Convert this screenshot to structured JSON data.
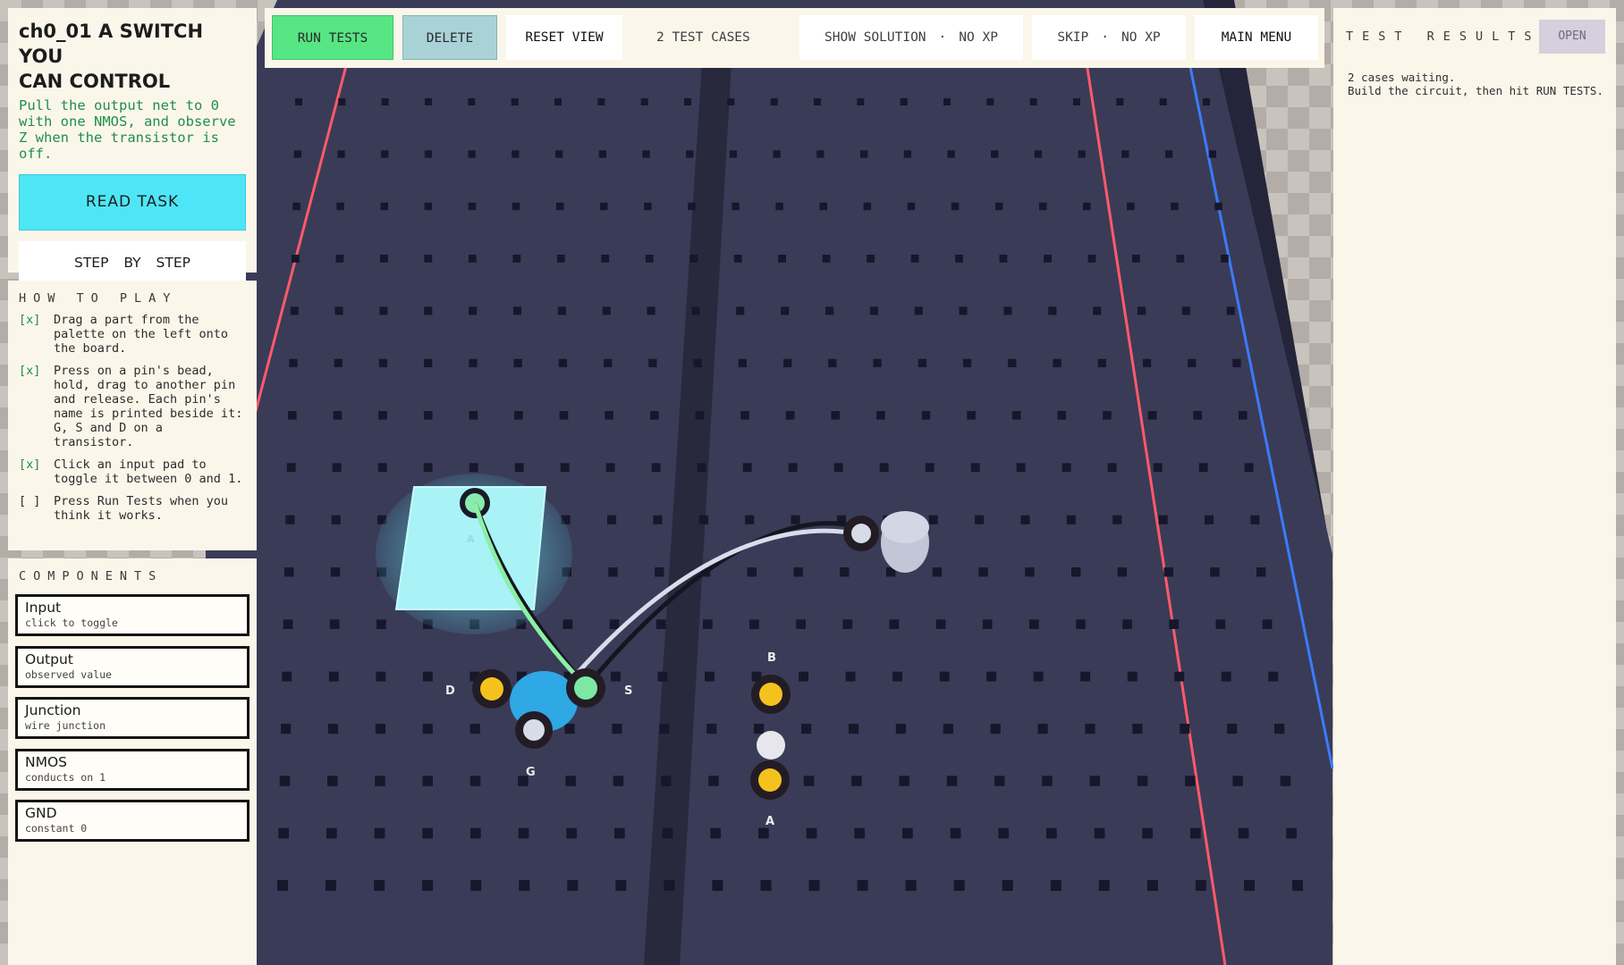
{
  "task": {
    "title": "ch0_01  A SWITCH YOU\nCAN CONTROL",
    "description": "Pull the output net to 0 with one NMOS, and observe Z when the transistor is off.",
    "read_task_label": "READ TASK",
    "step_by_step_label": "STEP  BY  STEP"
  },
  "how_to_play": {
    "heading": "HOW TO PLAY",
    "steps": [
      {
        "mark": "[x]",
        "text": "Drag a part from the palette on the left onto the board.",
        "done": true
      },
      {
        "mark": "[x]",
        "text": "Press on a pin's bead, hold, drag to another pin and release. Each pin's name is printed beside it: G, S and D on a transistor.",
        "done": true
      },
      {
        "mark": "[x]",
        "text": "Click an input pad to toggle it between 0 and 1.",
        "done": true
      },
      {
        "mark": "[ ]",
        "text": "Press Run Tests when you think it works.",
        "done": false
      }
    ]
  },
  "components": {
    "heading": "COMPONENTS",
    "items": [
      {
        "name": "Input",
        "sub": "click to toggle"
      },
      {
        "name": "Output",
        "sub": "observed value"
      },
      {
        "name": "Junction",
        "sub": "wire junction"
      },
      {
        "name": "NMOS",
        "sub": "conducts on 1"
      },
      {
        "name": "GND",
        "sub": "constant 0"
      }
    ]
  },
  "toolbar": {
    "run_tests": "RUN TESTS",
    "delete": "DELETE",
    "reset_view": "RESET VIEW",
    "test_cases": "2 TEST CASES",
    "show_solution": "SHOW SOLUTION",
    "show_solution_cost": "NO XP",
    "skip": "SKIP",
    "skip_cost": "NO XP",
    "separator": "·",
    "main_menu": "MAIN MENU"
  },
  "results": {
    "heading": "TEST RESULTS",
    "open_label": "OPEN",
    "line1": "2 cases waiting.",
    "line2": "Build the circuit, then hit RUN TESTS."
  },
  "board": {
    "pins": {
      "input_pad": "A",
      "nmos_drain": "D",
      "nmos_source": "S",
      "nmos_gate": "G",
      "output_top": "B",
      "output_bottom": "A"
    }
  },
  "colors": {
    "run_tests": "#56e683",
    "delete": "#a9d2d6",
    "read_task": "#4ee6f7",
    "done_mark": "#1f8f4a",
    "board": "#3b3c58",
    "rail_red": "#ff5a6a",
    "rail_blue": "#3b7bff",
    "pin_yellow": "#f4c21c",
    "pin_green": "#7be8a4",
    "nmos_body": "#2fa8e6"
  }
}
